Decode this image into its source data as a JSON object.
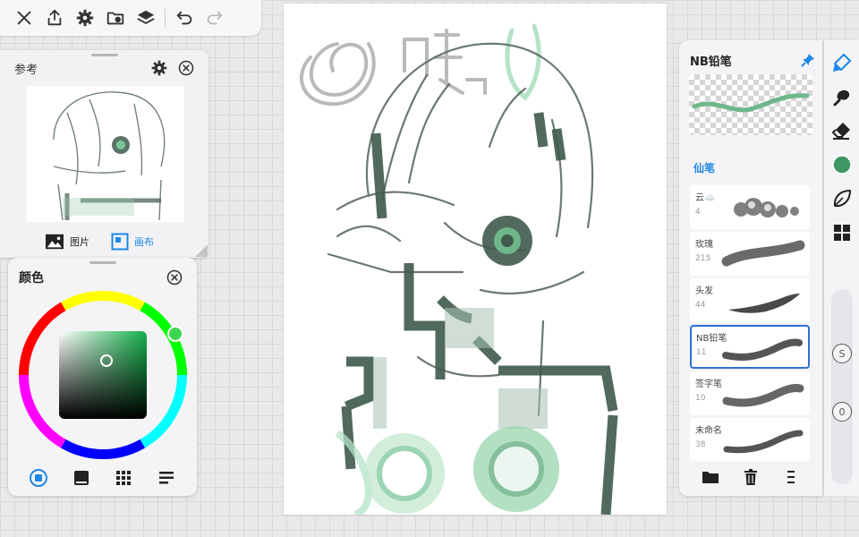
{
  "toolbar": {
    "buttons": [
      "close-icon",
      "share-icon",
      "gear-icon",
      "import-icon",
      "layers-icon",
      "undo-icon",
      "redo-icon"
    ]
  },
  "reference": {
    "title": "参考",
    "tabs": [
      {
        "label": "图片",
        "icon": "image-icon",
        "active": false
      },
      {
        "label": "画布",
        "icon": "canvas-icon",
        "active": true
      }
    ]
  },
  "color": {
    "title": "颜色",
    "current_color": "#2e8b57",
    "tabs": [
      "disc-icon",
      "classic-icon",
      "palette-grid-icon",
      "slider-bars-icon"
    ]
  },
  "brush": {
    "current_name": "NB铅笔",
    "category": "仙笔",
    "items": [
      {
        "name": "云☁️",
        "size": "4"
      },
      {
        "name": "玫瑰",
        "size": "215"
      },
      {
        "name": "头发",
        "size": "44"
      },
      {
        "name": "NB铅笔",
        "size": "11",
        "selected": true
      },
      {
        "name": "签字笔",
        "size": "10"
      },
      {
        "name": "未命名",
        "size": "38"
      }
    ],
    "footer": [
      "folder-icon",
      "trash-icon",
      "more-icon"
    ]
  },
  "tools": {
    "items": [
      "brush-icon",
      "smudge-icon",
      "eraser-icon",
      "color-swatch",
      "leaf-icon",
      "layers-grid-icon"
    ],
    "size_knob_label": "S",
    "opacity_knob_label": "0"
  },
  "colors": {
    "accent": "#1e88e5",
    "selected_border": "#2f6fd6",
    "ink_green": "#3f5a4c",
    "mint": "#7cc79a"
  }
}
